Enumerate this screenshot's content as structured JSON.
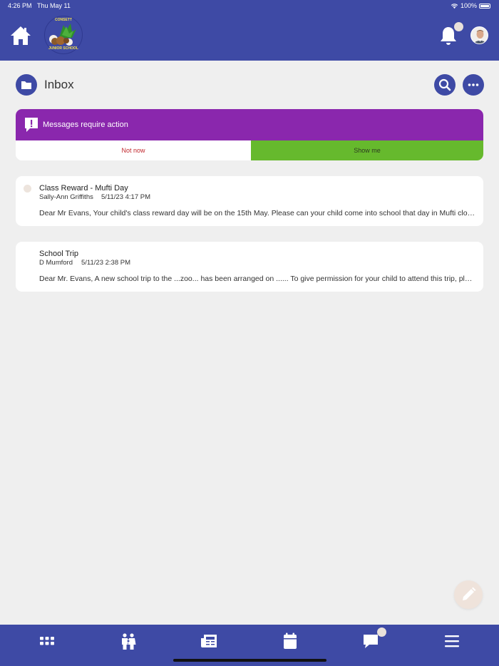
{
  "status_bar": {
    "time": "4:26 PM",
    "day": "Thu May 11",
    "battery": "100%"
  },
  "header": {
    "logo_top_text": "CONSETT",
    "logo_bottom_text": "JUNIOR SCHOOL",
    "icons": [
      "home-icon",
      "bell-icon",
      "avatar"
    ]
  },
  "inbox": {
    "title": "Inbox",
    "icons": [
      "folder-icon",
      "search-icon",
      "more-icon"
    ]
  },
  "action_banner": {
    "text": "Messages require action",
    "not_now_label": "Not now",
    "show_me_label": "Show me",
    "colors": {
      "banner": "#8a27ad",
      "not_now_text": "#c0262c",
      "show_me_bg": "#66b92d"
    }
  },
  "messages": [
    {
      "subject": "Class Reward - Mufti Day",
      "sender": "Sally-Ann Griffiths",
      "date": "5/11/23 4:17 PM",
      "preview": "Dear Mr Evans, Your child's class reward day will be on the 15th May. Please can your child come into school that day in Mufti clothes.",
      "unread": true
    },
    {
      "subject": "School Trip",
      "sender": "D Mumford",
      "date": "5/11/23 2:38 PM",
      "preview": "Dear Mr. Evans, A new school trip to the ...zoo... has been arranged on ...... To give permission for your child to attend this trip, please reply.",
      "unread": false
    }
  ],
  "compose": {
    "icon": "pencil-icon"
  },
  "bottom_nav": {
    "items": [
      "apps-icon",
      "people-icon",
      "news-icon",
      "calendar-icon",
      "chat-icon",
      "menu-icon"
    ]
  },
  "colors": {
    "primary": "#3e4aa5",
    "background": "#efefef"
  }
}
